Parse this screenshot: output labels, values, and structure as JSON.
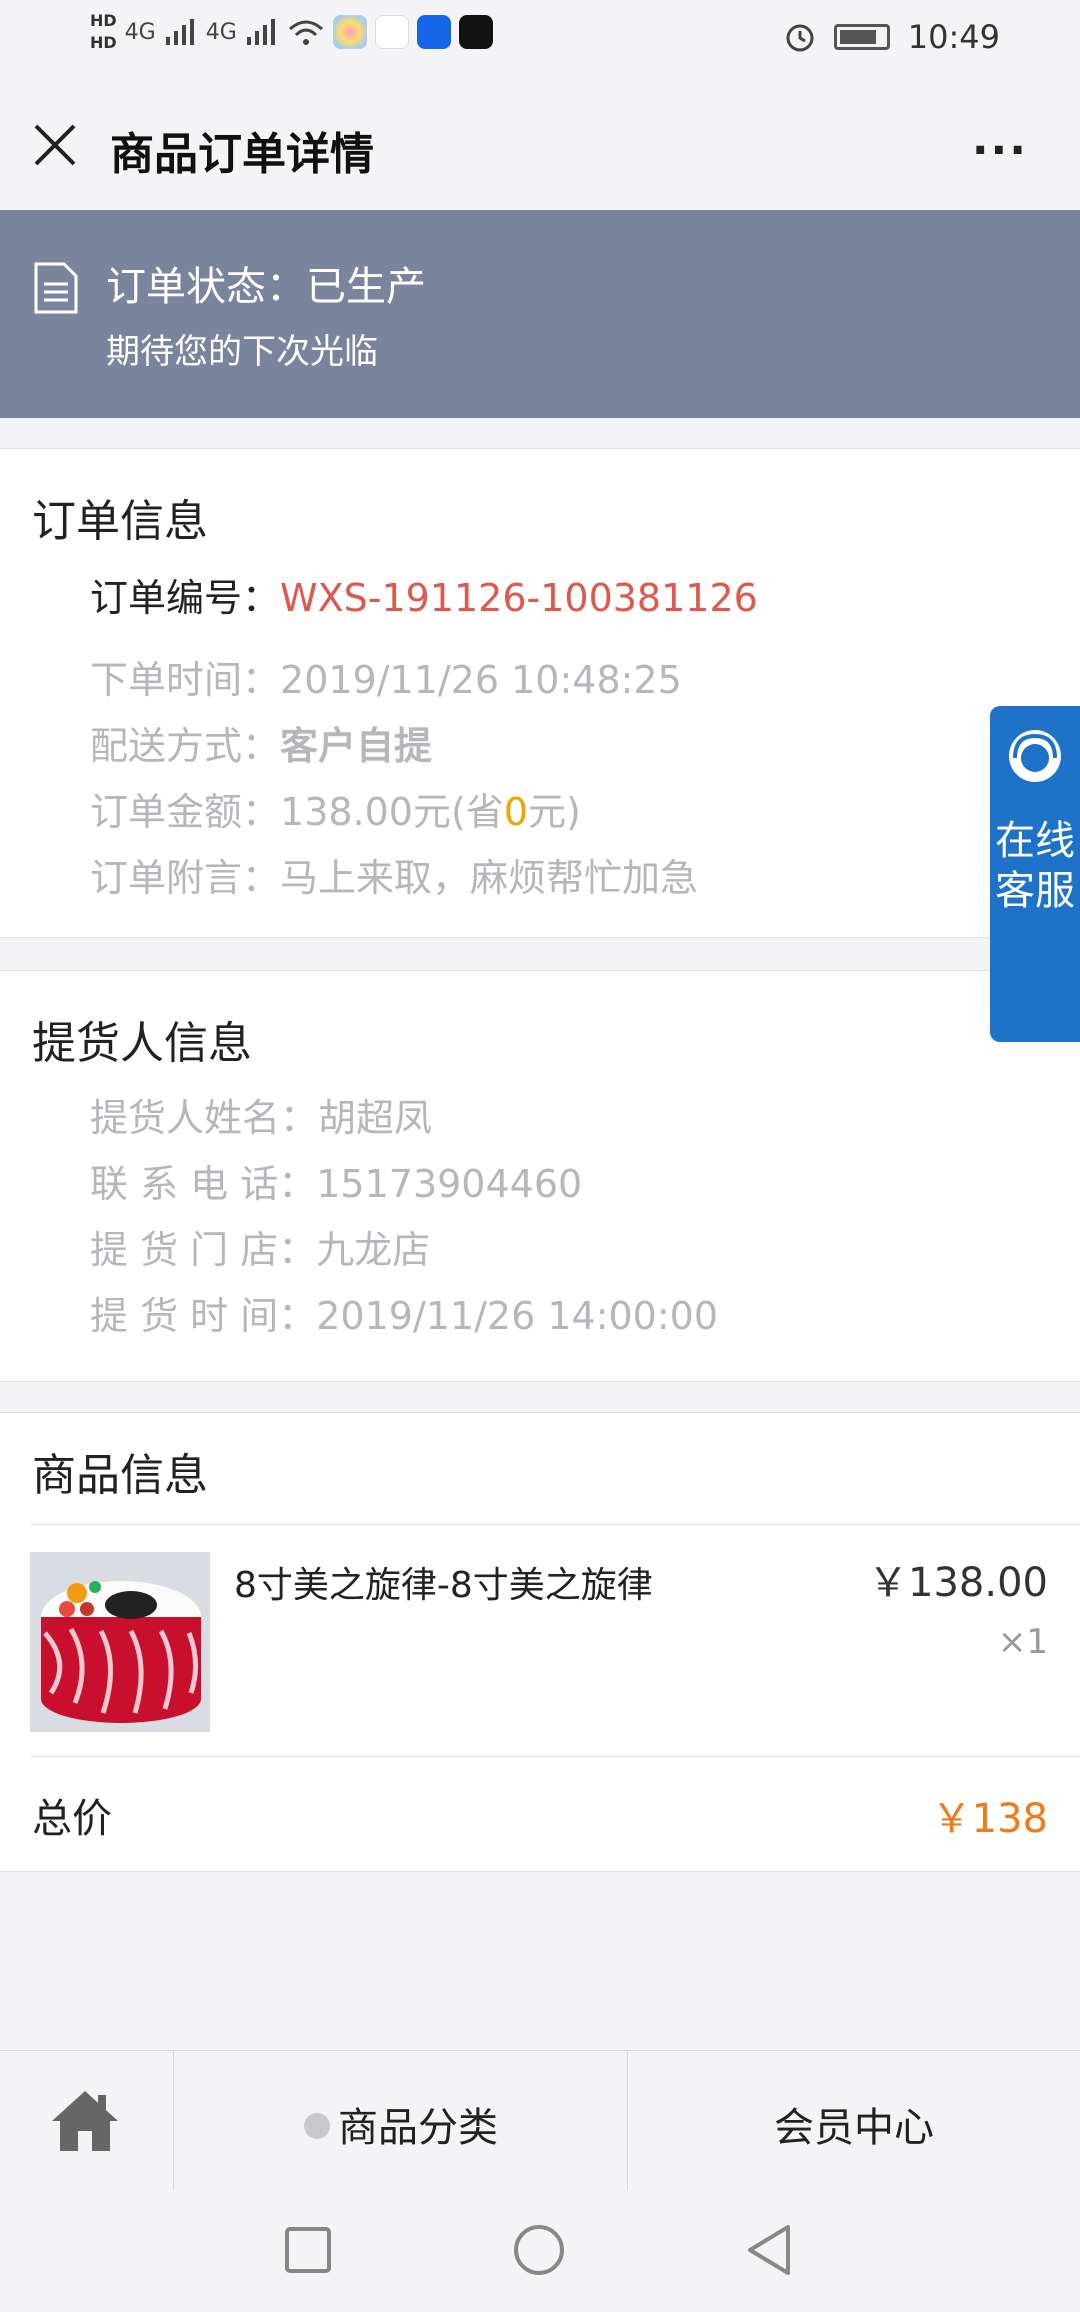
{
  "status_bar": {
    "hd1": "HD",
    "hd2": "HD",
    "signal1": "4G",
    "signal2": "4G",
    "time": "10:49"
  },
  "header": {
    "title": "商品订单详情",
    "more": "···"
  },
  "status_banner": {
    "status_label": "订单状态：",
    "status_value": "已生产",
    "subtitle": "期待您的下次光临"
  },
  "order_info": {
    "title": "订单信息",
    "order_no_label": "订单编号：",
    "order_no": "WXS-191126-100381126",
    "order_time_label": "下单时间：",
    "order_time": "2019/11/26 10:48:25",
    "delivery_label": "配送方式：",
    "delivery": "客户自提",
    "amount_label": "订单金额：",
    "amount": "138.00元(省",
    "saved": "0",
    "amount_suffix": "元)",
    "note_label": "订单附言：",
    "note": "马上来取，麻烦帮忙加急"
  },
  "pickup_info": {
    "title": "提货人信息",
    "name_label": "提货人姓名：",
    "name": "胡超凤",
    "phone_label": "联 系 电 话：",
    "phone": "15173904460",
    "store_label": "提 货 门 店：",
    "store": "九龙店",
    "time_label": "提 货 时 间：",
    "time": "2019/11/26 14:00:00"
  },
  "goods_info": {
    "title": "商品信息",
    "items": [
      {
        "name": "8寸美之旋律-8寸美之旋律",
        "price": "￥138.00",
        "qty": "×1"
      }
    ],
    "total_label": "总价",
    "total": "￥138"
  },
  "service_tab": {
    "text": "在线客服"
  },
  "bottom_nav": {
    "category": "商品分类",
    "member": "会员中心"
  },
  "colors": {
    "banner": "#7a849d",
    "order_no": "#e0574e",
    "saved": "#f0a400",
    "total": "#f07a1a",
    "service": "#1e73c8"
  }
}
